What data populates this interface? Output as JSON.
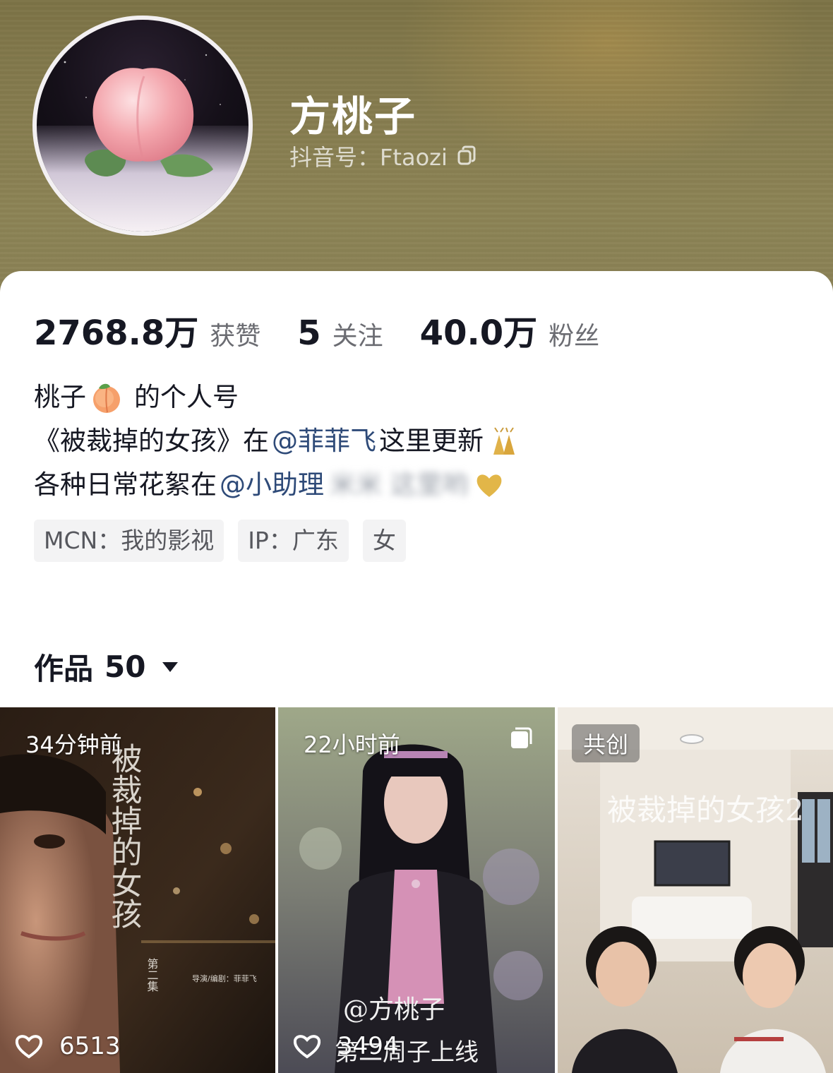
{
  "profile": {
    "name": "方桃子",
    "douyin_id": "抖音号：Ftaozi"
  },
  "stats": [
    {
      "value": "2768.8万",
      "label": "获赞"
    },
    {
      "value": "5",
      "label": "关注"
    },
    {
      "value": "40.0万",
      "label": "粉丝"
    }
  ],
  "bio": {
    "line1": {
      "a": "桃子",
      "emoji": "peach-emoji",
      "b": "的个人号"
    },
    "line2": {
      "a": "《被裁掉的女孩》在",
      "mention": "@菲菲飞",
      "b": "这里更新",
      "emoji": "celebrate-emoji"
    },
    "line3": {
      "a": "各种日常花絮在",
      "mention": "@小助理",
      "blurred": "米米 这里哟",
      "emoji": "heart-emoji"
    }
  },
  "tags": [
    "MCN：我的影视",
    "IP：广东",
    "女"
  ],
  "works": {
    "label": "作品",
    "count": "50"
  },
  "videos": [
    {
      "time": "34分钟前",
      "likes": "6513",
      "poster_title": "被裁掉的女孩",
      "poster_sub": "第二集",
      "poster_credit": "导演/编剧：菲菲飞"
    },
    {
      "time": "22小时前",
      "likes": "3494",
      "poster_title": "@方桃子",
      "poster_sub": "第二周子上线"
    },
    {
      "time": "共创",
      "likes": "",
      "poster_title": "被裁掉的女孩2"
    }
  ],
  "colors": {
    "header_bg": "#857b4e",
    "mention": "#2e4a78",
    "text": "#161823",
    "muted": "#6b6c72",
    "tag_bg": "#f3f3f4"
  }
}
